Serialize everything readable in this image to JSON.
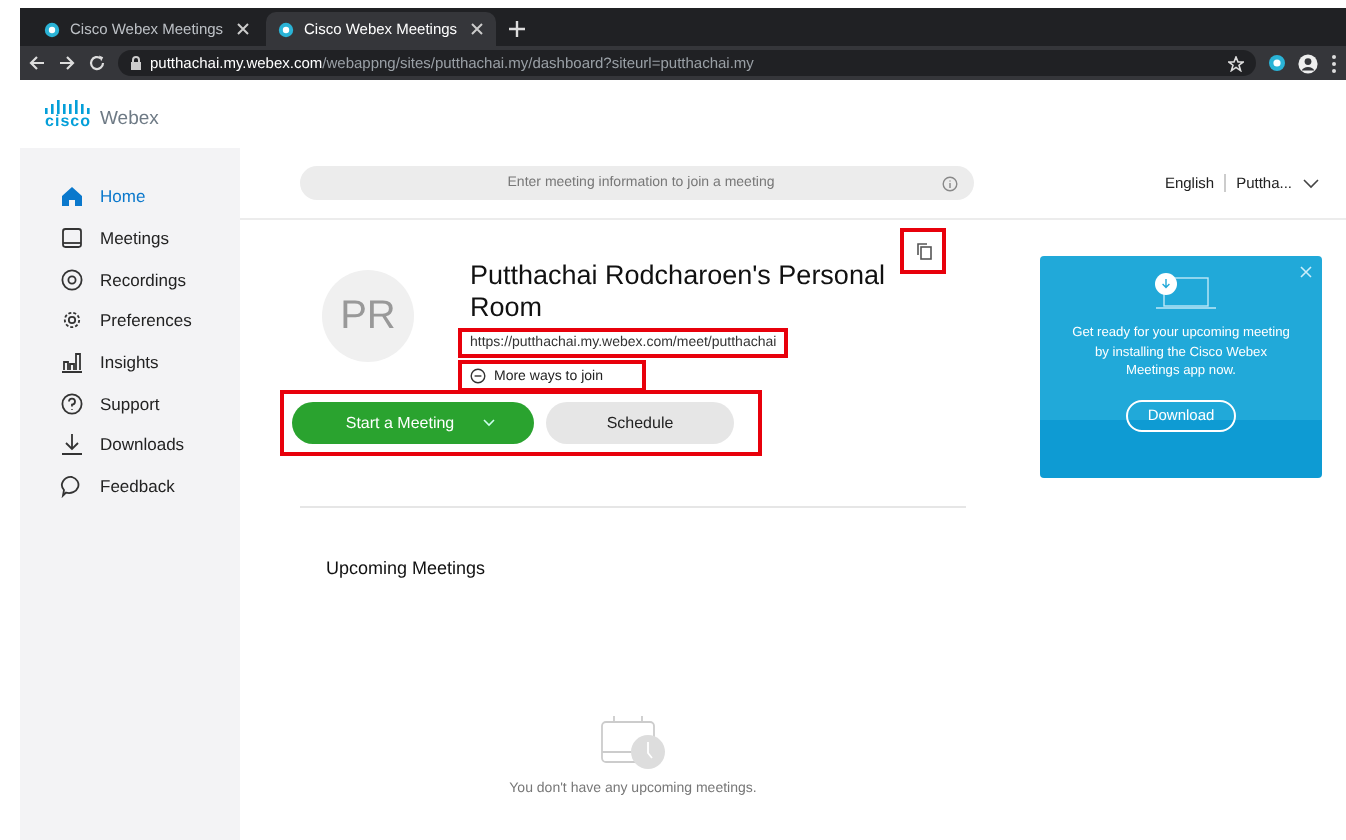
{
  "browser": {
    "tabs": [
      {
        "title": "Cisco Webex Meetings",
        "selected": false
      },
      {
        "title": "Cisco Webex Meetings",
        "selected": true
      }
    ],
    "url_host": "putthachai.my.webex.com",
    "url_path": "/webappng/sites/putthachai.my/dashboard?siteurl=putthachai.my"
  },
  "logo": {
    "brand": "cisco",
    "product": "Webex"
  },
  "sidebar": {
    "items": [
      {
        "label": "Home",
        "selected": true
      },
      {
        "label": "Meetings",
        "selected": false
      },
      {
        "label": "Recordings",
        "selected": false
      },
      {
        "label": "Preferences",
        "selected": false
      },
      {
        "label": "Insights",
        "selected": false
      },
      {
        "label": "Support",
        "selected": false
      },
      {
        "label": "Downloads",
        "selected": false
      },
      {
        "label": "Feedback",
        "selected": false
      }
    ]
  },
  "join_field": {
    "placeholder": "Enter meeting information to join a meeting"
  },
  "header": {
    "language": "English",
    "user": "Puttha..."
  },
  "room": {
    "initials": "PR",
    "title": "Putthachai Rodcharoen's Personal Room",
    "link": "https://putthachai.my.webex.com/meet/putthachai",
    "more_ways": "More ways to join",
    "start_button": "Start a Meeting",
    "schedule_button": "Schedule"
  },
  "promo": {
    "message": "Get ready for your upcoming meeting by installing the Cisco Webex Meetings app now.",
    "button": "Download"
  },
  "upcoming": {
    "heading": "Upcoming Meetings",
    "empty_message": "You don't have any upcoming meetings."
  }
}
